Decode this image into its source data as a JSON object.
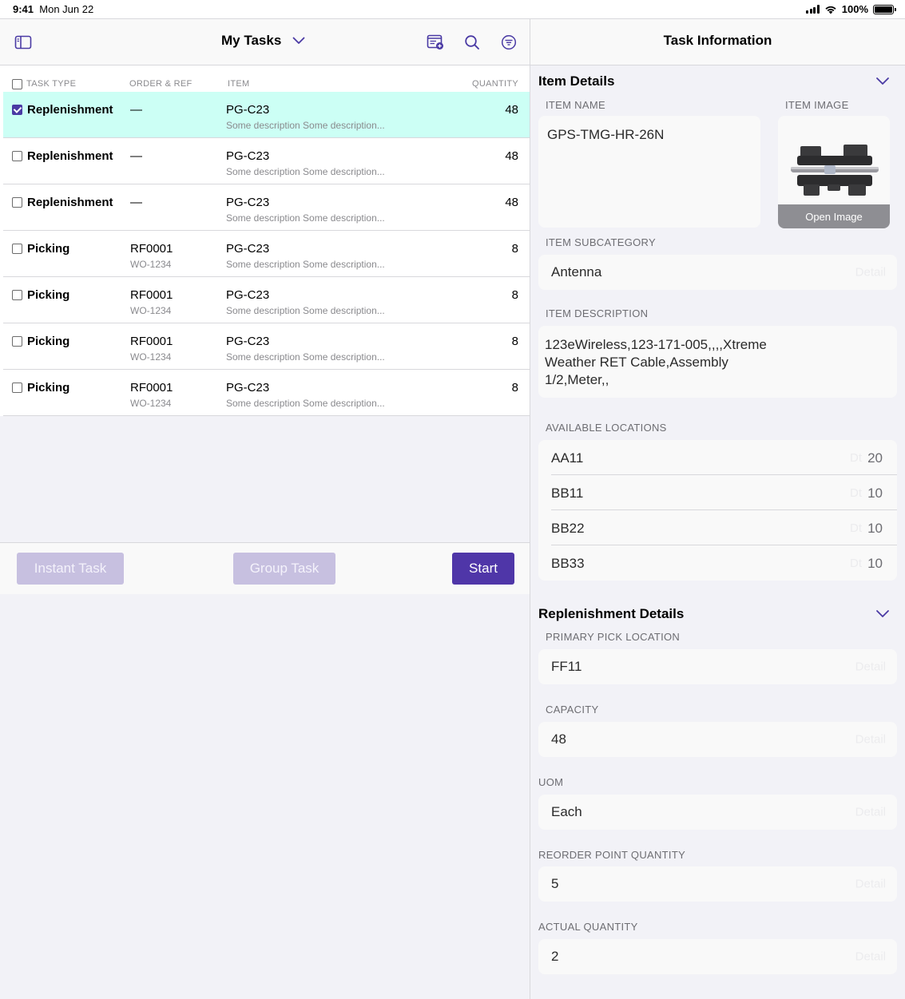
{
  "status_bar": {
    "time": "9:41",
    "date": "Mon Jun 22",
    "battery": "100%",
    "battery_level": 1.0
  },
  "left_header": {
    "title": "My Tasks"
  },
  "columns": {
    "task_type": "TASK TYPE",
    "order_ref": "ORDER & REF",
    "item": "ITEM",
    "quantity": "QUANTITY"
  },
  "tasks": [
    {
      "type": "Replenishment",
      "order": "—",
      "ref": "",
      "item": "PG-C23",
      "desc": "Some description Some description...",
      "qty": "48",
      "checked": true
    },
    {
      "type": "Replenishment",
      "order": "—",
      "ref": "",
      "item": "PG-C23",
      "desc": "Some description Some description...",
      "qty": "48",
      "checked": false
    },
    {
      "type": "Replenishment",
      "order": "—",
      "ref": "",
      "item": "PG-C23",
      "desc": "Some description Some description...",
      "qty": "48",
      "checked": false
    },
    {
      "type": "Picking",
      "order": "RF0001",
      "ref": "WO-1234",
      "item": "PG-C23",
      "desc": "Some description Some description...",
      "qty": "8",
      "checked": false
    },
    {
      "type": "Picking",
      "order": "RF0001",
      "ref": "WO-1234",
      "item": "PG-C23",
      "desc": "Some description Some description...",
      "qty": "8",
      "checked": false
    },
    {
      "type": "Picking",
      "order": "RF0001",
      "ref": "WO-1234",
      "item": "PG-C23",
      "desc": "Some description Some description...",
      "qty": "8",
      "checked": false
    },
    {
      "type": "Picking",
      "order": "RF0001",
      "ref": "WO-1234",
      "item": "PG-C23",
      "desc": "Some description Some description...",
      "qty": "8",
      "checked": false
    }
  ],
  "footer": {
    "instant": "Instant Task",
    "group": "Group Task",
    "start": "Start"
  },
  "right_header": {
    "title": "Task Information"
  },
  "item_details": {
    "title": "Item Details",
    "name_label": "ITEM NAME",
    "name": "GPS-TMG-HR-26N",
    "image_label": "ITEM IMAGE",
    "open_image": "Open Image",
    "subcat_label": "ITEM SUBCATEGORY",
    "subcat": "Antenna",
    "desc_label": "ITEM DESCRIPTION",
    "desc_lines": [
      "123eWireless,123-171-005,,,,Xtreme",
      "Weather RET Cable,Assembly",
      "1/2,Meter,,"
    ],
    "loc_label": "AVAILABLE LOCATIONS",
    "locations": [
      {
        "name": "AA11",
        "qty": "20"
      },
      {
        "name": "BB11",
        "qty": "10"
      },
      {
        "name": "BB22",
        "qty": "10"
      },
      {
        "name": "BB33",
        "qty": "10"
      }
    ]
  },
  "replenishment": {
    "title": "Replenishment Details",
    "primary_label": "PRIMARY PICK LOCATION",
    "primary": "FF11",
    "capacity_label": "CAPACITY",
    "capacity": "48",
    "uom_label": "UOM",
    "uom": "Each",
    "reorder_label": "REORDER POINT QUANTITY",
    "reorder": "5",
    "actual_label": "ACTUAL QUANTITY",
    "actual": "2"
  },
  "colors": {
    "accent": "#4f36a8",
    "selected_row": "#ccfff5",
    "disabled_button": "#c7c0e0"
  }
}
